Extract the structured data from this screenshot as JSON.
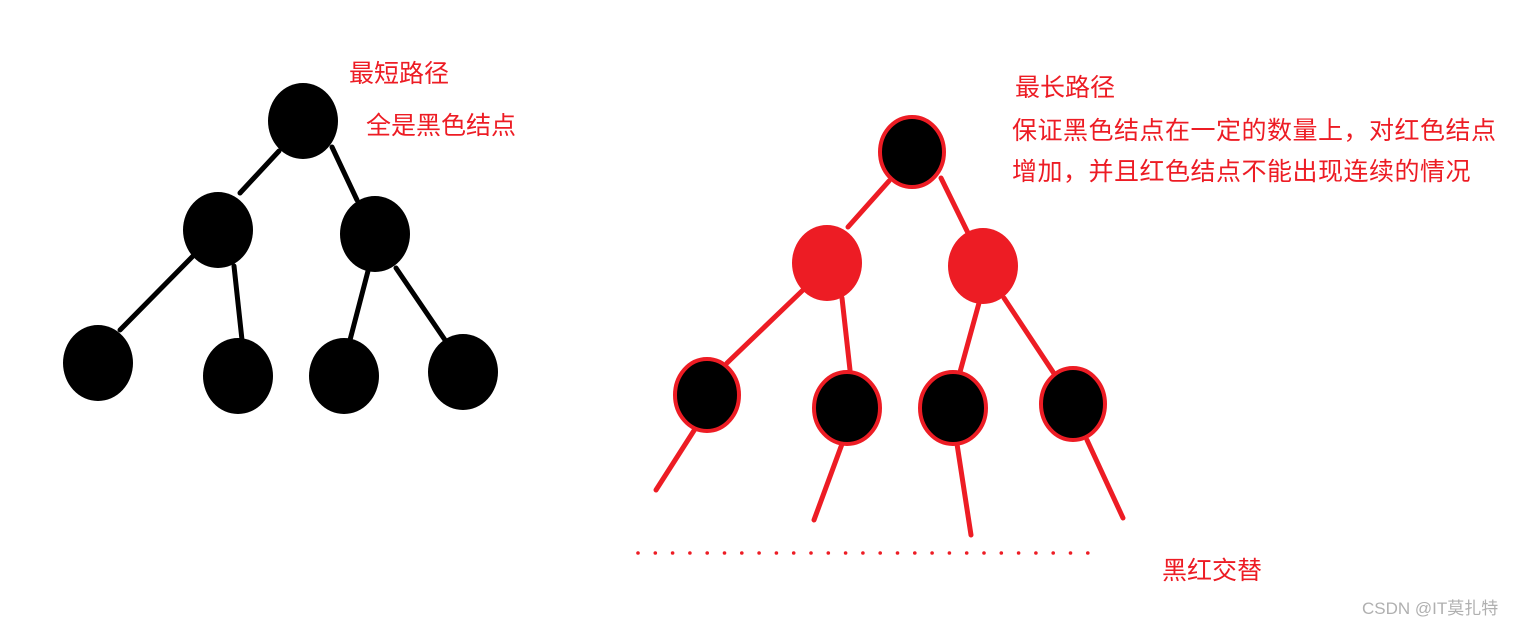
{
  "colors": {
    "red": "#ed1c24",
    "black": "#000000",
    "background": "#ffffff",
    "watermark": "#b0b0b0"
  },
  "left_tree": {
    "title": "最短路径",
    "subtitle": "全是黑色结点",
    "levels": [
      [
        "black"
      ],
      [
        "black",
        "black"
      ],
      [
        "black",
        "black",
        "black",
        "black"
      ]
    ]
  },
  "right_tree": {
    "title": "最长路径",
    "description": "保证黑色结点在一定的数量上，对红色结点增加，并且红色结点不能出现连续的情况",
    "levels": [
      [
        "black",
        "black"
      ],
      [
        "red",
        "red"
      ],
      [
        "black",
        "black",
        "black",
        "black"
      ]
    ],
    "continuation_label": "黑红交替"
  },
  "watermark": "CSDN @IT莫扎特"
}
